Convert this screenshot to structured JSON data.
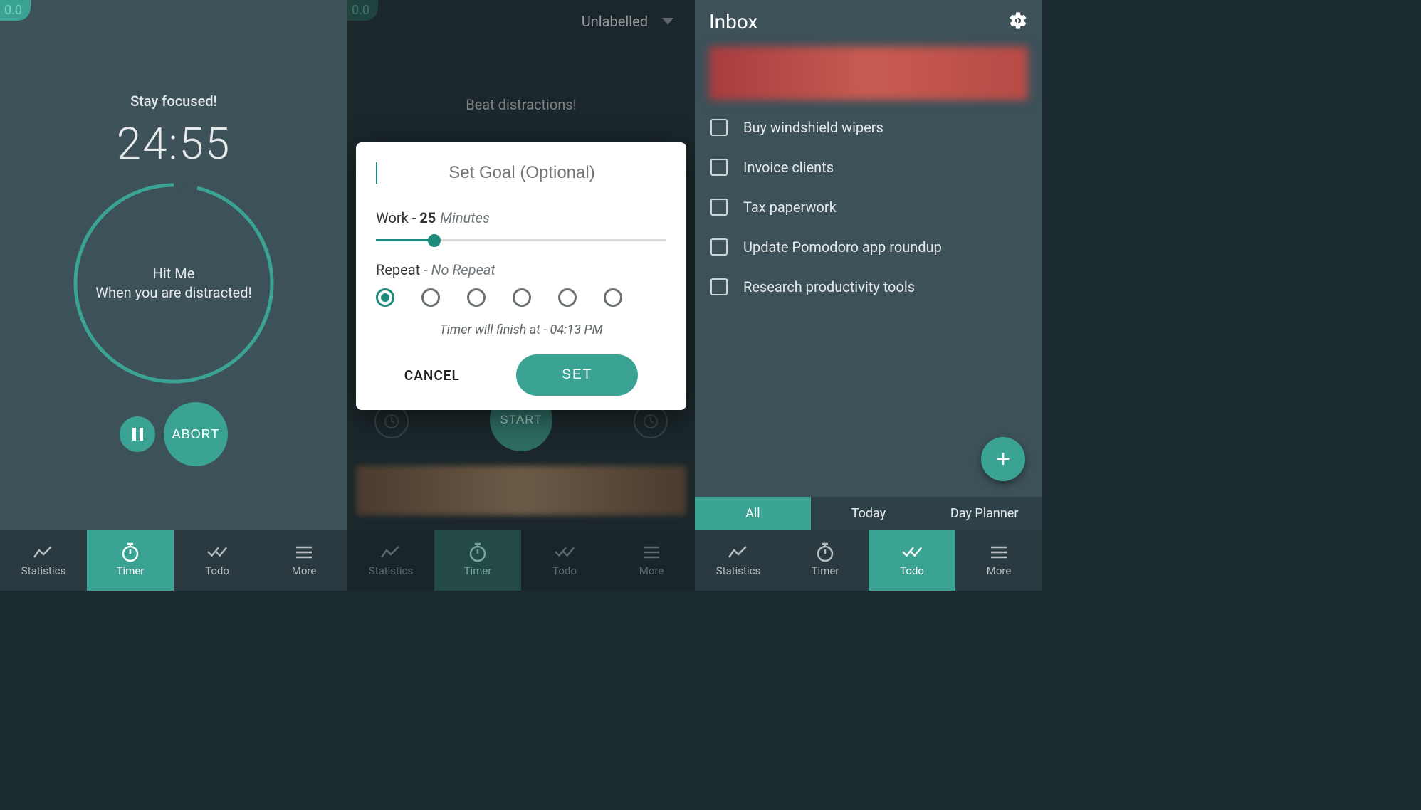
{
  "version_badge": "0.0",
  "screen1": {
    "heading": "Stay focused!",
    "time": "24:55",
    "circle_line1": "Hit Me",
    "circle_line2": "When you are distracted!",
    "abort_label": "ABORT"
  },
  "screen2": {
    "label_dropdown": "Unlabelled",
    "heading": "Beat distractions!",
    "start_label": "START",
    "dialog": {
      "goal_placeholder": "Set Goal (Optional)",
      "work_prefix": "Work - ",
      "work_value": "25",
      "work_unit": "Minutes",
      "repeat_prefix": "Repeat - ",
      "repeat_value": "No Repeat",
      "finish_text": "Timer will finish at - 04:13 PM",
      "cancel_label": "CANCEL",
      "set_label": "SET"
    }
  },
  "screen3": {
    "title": "Inbox",
    "items": [
      {
        "label": "Buy windshield wipers"
      },
      {
        "label": "Invoice clients"
      },
      {
        "label": "Tax paperwork"
      },
      {
        "label": "Update Pomodoro app roundup"
      },
      {
        "label": "Research productivity tools"
      }
    ],
    "filters": {
      "all": "All",
      "today": "Today",
      "planner": "Day Planner"
    }
  },
  "nav": {
    "statistics": "Statistics",
    "timer": "Timer",
    "todo": "Todo",
    "more": "More"
  }
}
